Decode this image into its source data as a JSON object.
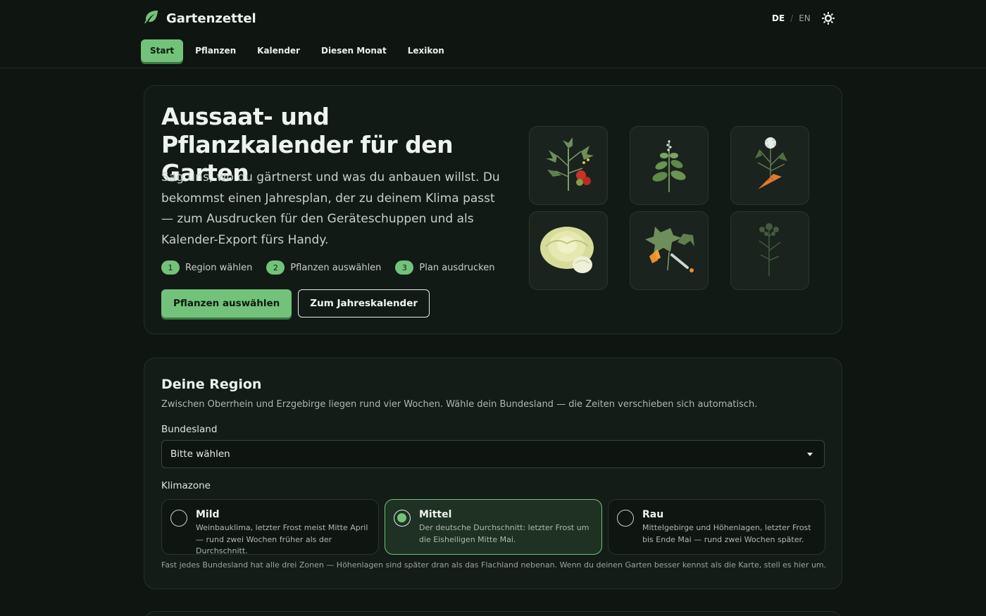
{
  "app": {
    "name": "Gartenzettel",
    "accent": "#73c27a"
  },
  "lang": {
    "de": "DE",
    "sep": "/",
    "en": "EN"
  },
  "nav": {
    "items": [
      {
        "label": "Start"
      },
      {
        "label": "Pflanzen"
      },
      {
        "label": "Kalender"
      },
      {
        "label": "Diesen Monat"
      },
      {
        "label": "Lexikon"
      }
    ]
  },
  "hero": {
    "title": "Aussaat- und Pflanzkalender für den Garten",
    "lead": "Sag uns, wo du gärtnerst und was du anbauen willst. Du bekommst einen Jahresplan, der zu deinem Klima passt — zum Ausdrucken für den Geräteschuppen und als Kalender-Export fürs Handy.",
    "steps": [
      {
        "num": "1",
        "label": "Region wählen"
      },
      {
        "num": "2",
        "label": "Pflanzen auswählen"
      },
      {
        "num": "3",
        "label": "Plan ausdrucken"
      }
    ],
    "primary_button": "Pflanzen auswählen",
    "secondary_button": "Zum Jahreskalender",
    "tiles": [
      "tomato-plant-icon",
      "basil-plant-icon",
      "carrot-plant-icon",
      "cabbage-icon",
      "zucchini-plant-icon",
      "dill-plant-icon"
    ]
  },
  "region": {
    "title": "Deine Region",
    "intro": "Zwischen Oberrhein und Erzgebirge liegen rund vier Wochen. Wähle dein Bundesland — die Zeiten verschieben sich automatisch.",
    "state_label": "Bundesland",
    "state_value": "Bitte wählen",
    "zone_label": "Klimazone",
    "zones": [
      {
        "title": "Mild",
        "desc": "Weinbauklima, letzter Frost meist Mitte April — rund zwei Wochen früher als der Durchschnitt."
      },
      {
        "title": "Mittel",
        "desc": "Der deutsche Durchschnitt: letzter Frost um die Eisheiligen Mitte Mai."
      },
      {
        "title": "Rau",
        "desc": "Mittelgebirge und Höhenlagen, letzter Frost bis Ende Mai — rund zwei Wochen später."
      }
    ],
    "note": "Fast jedes Bundesland hat alle drei Zonen — Höhenlagen sind später dran als das Flachland nebenan. Wenn du deinen Garten besser kennst als die Karte, stell es hier um."
  }
}
